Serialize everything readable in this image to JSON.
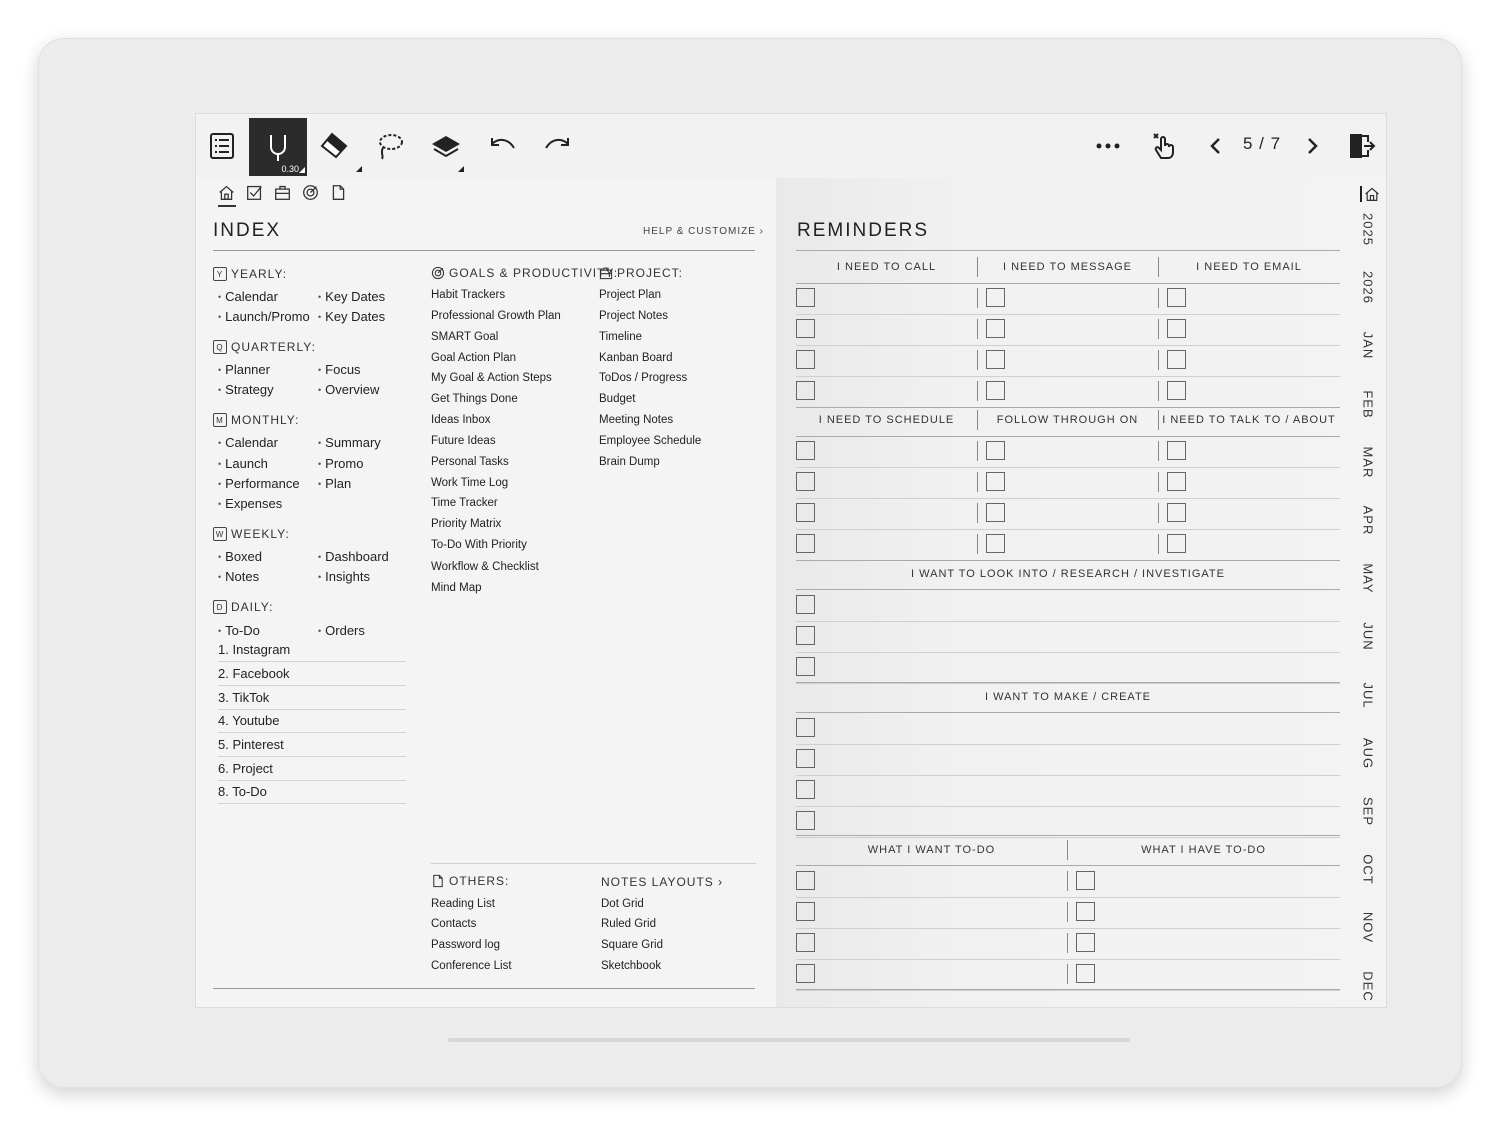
{
  "toolbar": {
    "pen_size": "0.30",
    "page_indicator": "5 / 7"
  },
  "index": {
    "title": "INDEX",
    "help": "HELP & CUSTOMIZE ›",
    "yearly": {
      "label": "YEARLY:",
      "box": "Y",
      "items": [
        "Calendar",
        "Key Dates",
        "Launch/Promo",
        "Key Dates"
      ]
    },
    "quarterly": {
      "label": "QUARTERLY:",
      "box": "Q",
      "items": [
        "Planner",
        "Focus",
        "Strategy",
        "Overview"
      ]
    },
    "monthly": {
      "label": "MONTHLY:",
      "box": "M",
      "items": [
        "Calendar",
        "Summary",
        "Launch",
        "Promo",
        "Performance",
        "Plan",
        "Expenses"
      ]
    },
    "weekly": {
      "label": "WEEKLY:",
      "box": "W",
      "items": [
        "Boxed",
        "Dashboard",
        "Notes",
        "Insights"
      ]
    },
    "daily": {
      "label": "DAILY:",
      "box": "D",
      "items": [
        "To-Do",
        "Orders"
      ],
      "numbered": [
        "1. Instagram",
        "2. Facebook",
        "3. TikTok",
        "4. Youtube",
        "5. Pinterest",
        "6. Project",
        "8. To-Do"
      ]
    },
    "goals": {
      "label": "GOALS & PRODUCTIVITY:",
      "items": [
        "Habit Trackers",
        "Professional Growth Plan",
        "SMART Goal",
        "Goal Action Plan",
        "My Goal & Action Steps",
        "Get Things Done",
        "Ideas Inbox",
        "Future Ideas",
        "Personal Tasks",
        "Work Time Log",
        "Time Tracker",
        "Priority Matrix",
        "To-Do With Priority",
        "Workflow & Checklist",
        "Mind Map"
      ]
    },
    "project": {
      "label": "PROJECT:",
      "items": [
        "Project Plan",
        "Project Notes",
        "Timeline",
        "Kanban Board",
        "ToDos / Progress",
        "Budget",
        "Meeting Notes",
        "Employee Schedule",
        "Brain Dump"
      ]
    },
    "others": {
      "label": "OTHERS:",
      "items": [
        "Reading List",
        "Contacts",
        "Password log",
        "Conference List"
      ]
    },
    "notes_layouts": {
      "label": "NOTES LAYOUTS ›",
      "items": [
        "Dot Grid",
        "Ruled Grid",
        "Square Grid",
        "Sketchbook"
      ]
    }
  },
  "reminders": {
    "title": "REMINDERS",
    "row1": [
      "I NEED TO CALL",
      "I NEED TO MESSAGE",
      "I NEED TO EMAIL"
    ],
    "row2": [
      "I NEED TO SCHEDULE",
      "FOLLOW THROUGH ON",
      "I NEED TO TALK TO / ABOUT"
    ],
    "research": "I WANT TO LOOK INTO / RESEARCH / INVESTIGATE",
    "make": "I WANT TO MAKE / CREATE",
    "final": [
      "WHAT I WANT TO-DO",
      "WHAT I HAVE TO-DO"
    ]
  },
  "tabs": [
    "2025",
    "2026",
    "JAN",
    "FEB",
    "MAR",
    "APR",
    "MAY",
    "JUN",
    "JUL",
    "AUG",
    "SEP",
    "OCT",
    "NOV",
    "DEC"
  ]
}
